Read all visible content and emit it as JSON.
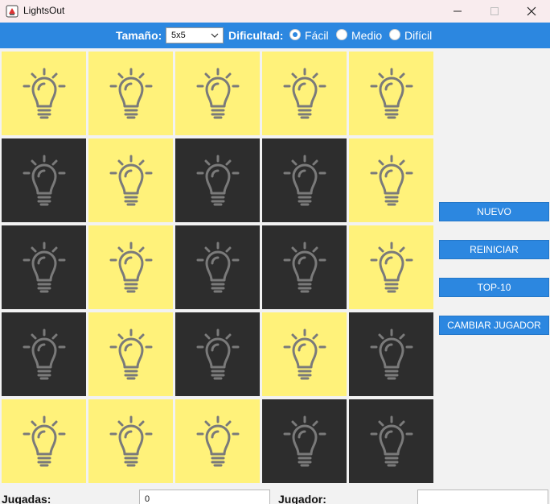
{
  "window": {
    "title": "LightsOut",
    "minimize_glyph": "—",
    "maximize_glyph": "☐",
    "close_glyph": "✕"
  },
  "toolbar": {
    "size_label": "Tamaño:",
    "size_value": "5x5",
    "difficulty_label": "Dificultad:",
    "difficulty_options": [
      {
        "label": "Fácil",
        "checked": true
      },
      {
        "label": "Medio",
        "checked": false
      },
      {
        "label": "Difícil",
        "checked": false
      }
    ]
  },
  "board": {
    "rows": 5,
    "cols": 5,
    "lights": [
      [
        1,
        1,
        1,
        1,
        1
      ],
      [
        0,
        1,
        0,
        0,
        1
      ],
      [
        0,
        1,
        0,
        0,
        1
      ],
      [
        0,
        1,
        0,
        1,
        0
      ],
      [
        1,
        1,
        1,
        0,
        0
      ]
    ],
    "icon": "lightbulb-icon",
    "on_color": "#fff27a",
    "off_color": "#2d2d2d"
  },
  "actions": {
    "new_label": "NUEVO",
    "restart_label": "REINICIAR",
    "top10_label": "TOP-10",
    "change_player_label": "CAMBIAR JUGADOR"
  },
  "status": {
    "moves_label": "Jugadas:",
    "moves_value": "0",
    "player_label": "Jugador:",
    "player_value": ""
  },
  "colors": {
    "accent": "#2c87e0",
    "titlebar": "#f9ecee",
    "background": "#f2f2f2"
  }
}
